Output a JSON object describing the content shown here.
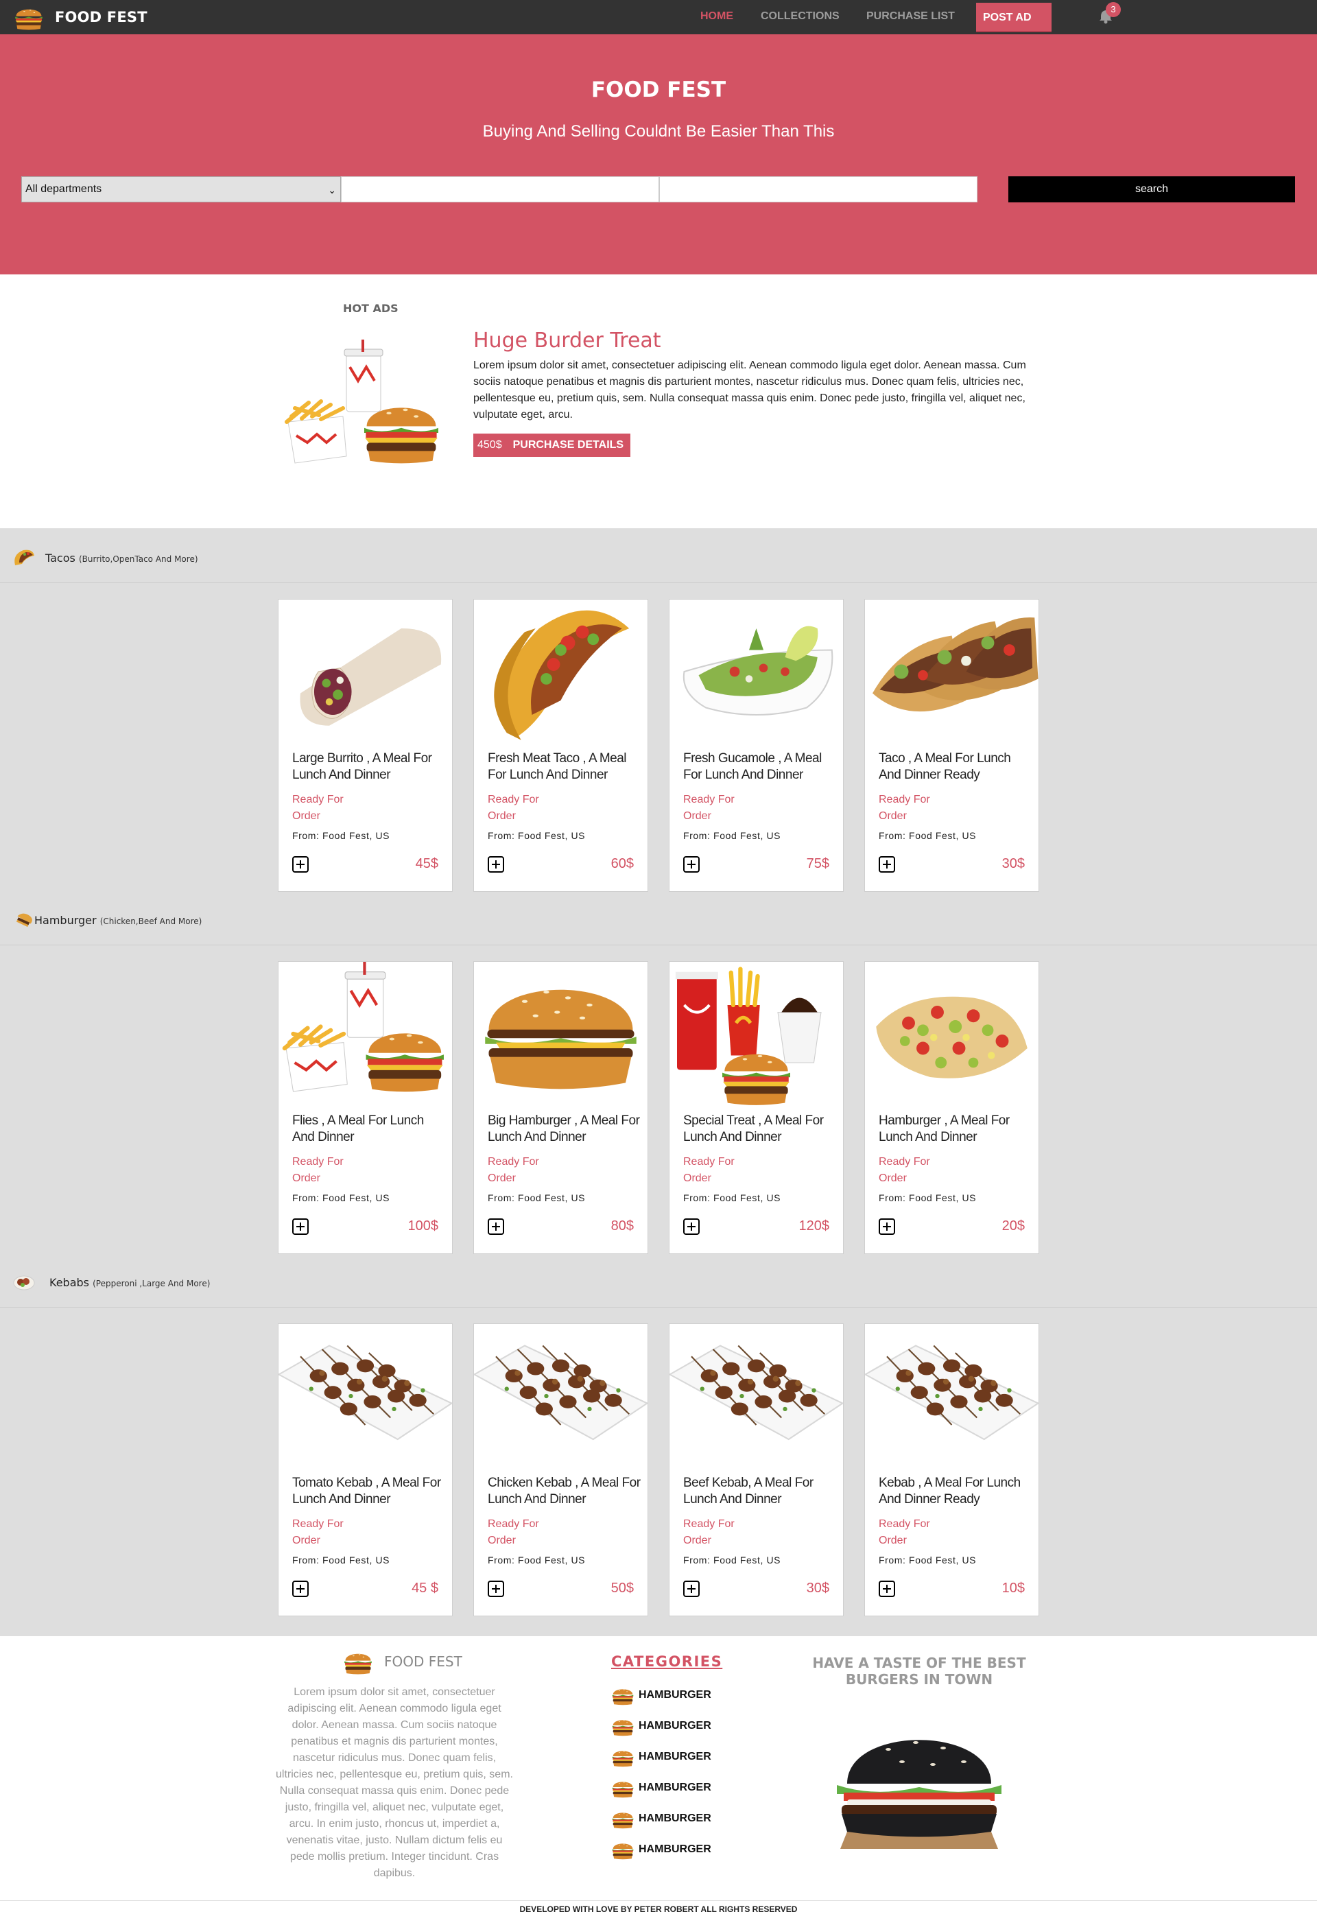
{
  "brand": {
    "name": "FOOD FEST"
  },
  "nav": {
    "items": [
      {
        "label": "HOME",
        "active": true
      },
      {
        "label": "COLLECTIONS",
        "active": false
      },
      {
        "label": "PURCHASE LIST",
        "active": false
      }
    ],
    "post_ad": "POST AD",
    "notifications": "3"
  },
  "hero": {
    "title": "FOOD FEST",
    "subtitle": "Buying And Selling Couldnt Be Easier Than This",
    "department_selected": "All departments",
    "search_label": "search"
  },
  "hot_ad": {
    "label": "HOT ADS",
    "title": "Huge Burder Treat",
    "body": "Lorem ipsum dolor sit amet, consectetuer adipiscing elit. Aenean commodo ligula eget dolor. Aenean massa. Cum sociis natoque penatibus et magnis dis parturient montes, nascetur ridiculus mus. Donec quam felis, ultricies nec, pellentesque eu, pretium quis, sem. Nulla consequat massa quis enim. Donec pede justo, fringilla vel, aliquet nec, vulputate eget, arcu.",
    "price": "450$",
    "cta": "PURCHASE DETAILS"
  },
  "categories": [
    {
      "name": "Tacos",
      "note": "(Burrito,OpenTaco And More)",
      "items": [
        {
          "title": "Large Burrito , A Meal For Lunch And Dinner",
          "status": "Ready For Order",
          "from": "From: Food Fest, US",
          "price": "45$"
        },
        {
          "title": "Fresh Meat Taco , A Meal For Lunch And Dinner",
          "status": "Ready For Order",
          "from": "From: Food Fest, US",
          "price": "60$"
        },
        {
          "title": "Fresh Gucamole , A Meal For Lunch And Dinner",
          "status": "Ready For Order",
          "from": "From: Food Fest, US",
          "price": "75$"
        },
        {
          "title": "Taco , A Meal For Lunch And Dinner Ready",
          "status": "Ready For Order",
          "from": "From: Food Fest, US",
          "price": "30$"
        }
      ]
    },
    {
      "name": "Hamburger",
      "note": "(Chicken,Beef And More)",
      "items": [
        {
          "title": "Flies , A Meal For Lunch And Dinner",
          "status": "Ready For Order",
          "from": "From: Food Fest, US",
          "price": "100$"
        },
        {
          "title": "Big Hamburger , A Meal For Lunch And Dinner",
          "status": "Ready For Order",
          "from": "From: Food Fest, US",
          "price": "80$"
        },
        {
          "title": "Special Treat , A Meal For Lunch And Dinner",
          "status": "Ready For Order",
          "from": "From: Food Fest, US",
          "price": "120$"
        },
        {
          "title": "Hamburger , A Meal For Lunch And Dinner",
          "status": "Ready For Order",
          "from": "From: Food Fest, US",
          "price": "20$"
        }
      ]
    },
    {
      "name": "Kebabs",
      "note": "(Pepperoni ,Large And More)",
      "items": [
        {
          "title": "Tomato Kebab , A Meal For Lunch And Dinner",
          "status": "Ready For Order",
          "from": "From: Food Fest, US",
          "price": "45 $"
        },
        {
          "title": "Chicken Kebab , A Meal For Lunch And Dinner",
          "status": "Ready For Order",
          "from": "From: Food Fest, US",
          "price": "50$"
        },
        {
          "title": "Beef Kebab, A Meal For Lunch And Dinner",
          "status": "Ready For Order",
          "from": "From: Food Fest, US",
          "price": "30$"
        },
        {
          "title": "Kebab , A Meal For Lunch And Dinner Ready",
          "status": "Ready For Order",
          "from": "From: Food Fest, US",
          "price": "10$"
        }
      ]
    }
  ],
  "footer": {
    "brand": "FOOD FEST",
    "about": "Lorem ipsum dolor sit amet, consectetuer adipiscing elit. Aenean commodo ligula eget dolor. Aenean massa. Cum sociis natoque penatibus et magnis dis parturient montes, nascetur ridiculus mus. Donec quam felis, ultricies nec, pellentesque eu, pretium quis, sem. Nulla consequat massa quis enim. Donec pede justo, fringilla vel, aliquet nec, vulputate eget, arcu. In enim justo, rhoncus ut, imperdiet a, venenatis vitae, justo. Nullam dictum felis eu pede mollis pretium. Integer tincidunt. Cras dapibus.",
    "categories_title": "CATEGORIES",
    "categories": [
      "HAMBURGER",
      "HAMBURGER",
      "HAMBURGER",
      "HAMBURGER",
      "HAMBURGER",
      "HAMBURGER"
    ],
    "tagline": "HAVE A TASTE OF THE BEST BURGERS IN TOWN",
    "copyright": "DEVELOPED WITH LOVE BY PETER ROBERT ALL RIGHTS RESERVED"
  },
  "colors": {
    "accent": "#d35364",
    "nav": "#333333",
    "band": "#dedede"
  }
}
